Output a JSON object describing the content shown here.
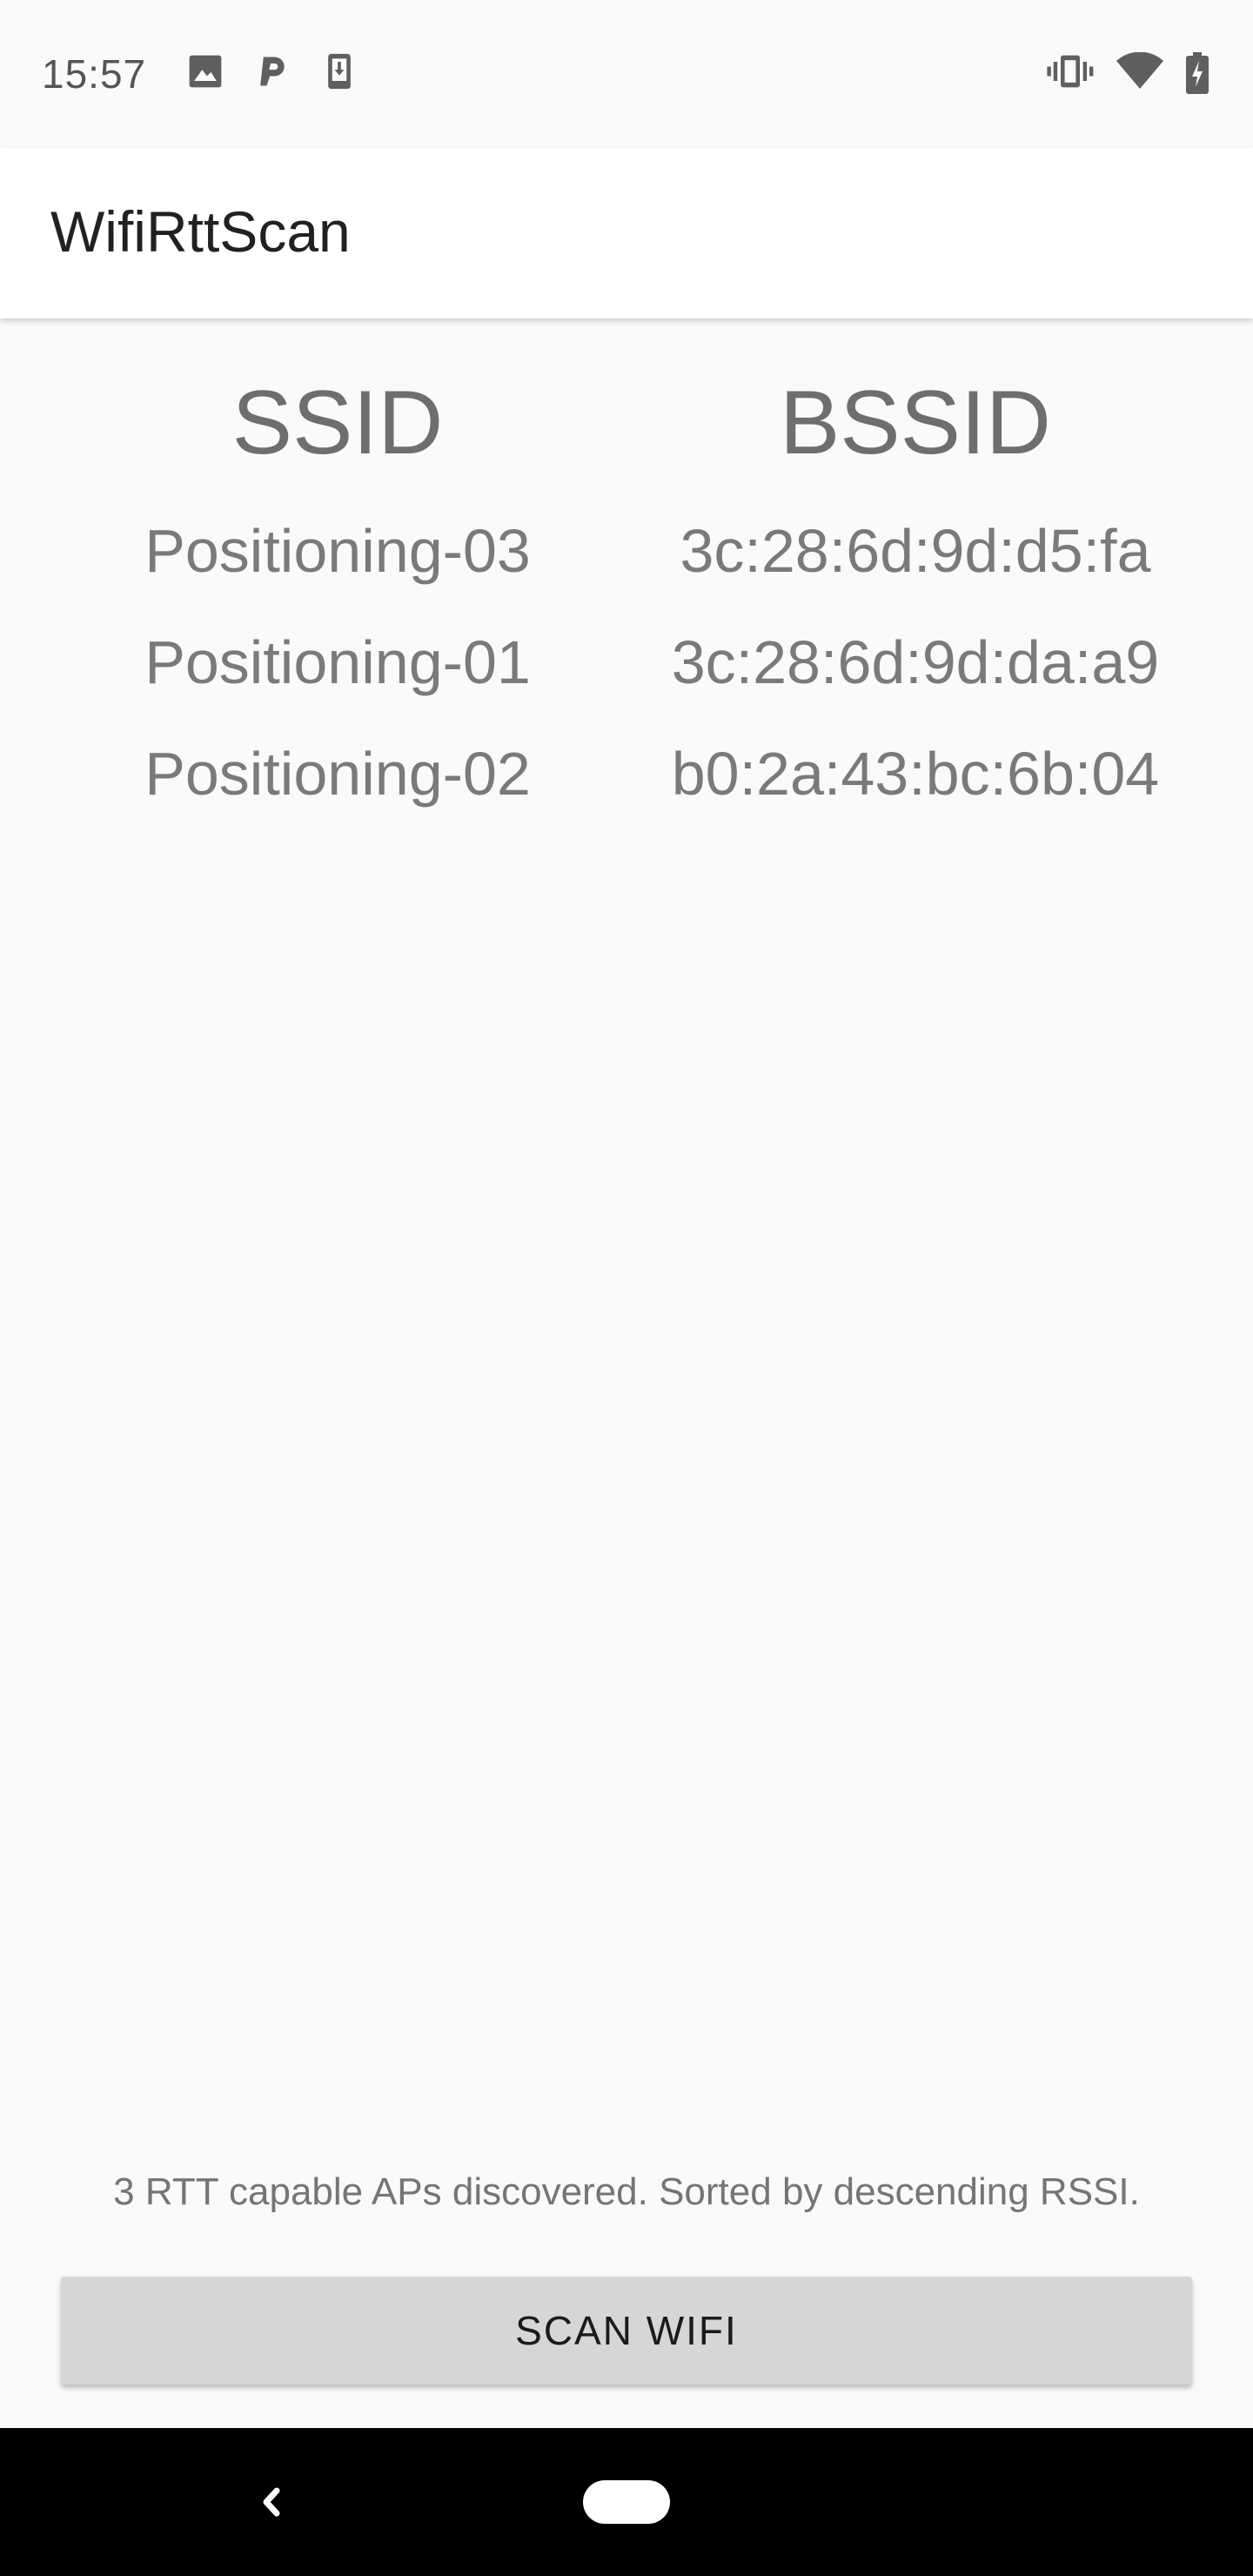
{
  "status_bar": {
    "time": "15:57",
    "left_icons": [
      "image-icon",
      "parking-icon",
      "download-icon"
    ],
    "right_icons": [
      "vibrate-icon",
      "wifi-icon",
      "battery-charging-icon"
    ]
  },
  "app_bar": {
    "title": "WifiRttScan"
  },
  "table": {
    "headers": {
      "ssid": "SSID",
      "bssid": "BSSID"
    },
    "rows": [
      {
        "ssid": "Positioning-03",
        "bssid": "3c:28:6d:9d:d5:fa"
      },
      {
        "ssid": "Positioning-01",
        "bssid": "3c:28:6d:9d:da:a9"
      },
      {
        "ssid": "Positioning-02",
        "bssid": "b0:2a:43:bc:6b:04"
      }
    ]
  },
  "footer": {
    "status_text": "3 RTT capable APs discovered. Sorted by descending RSSI."
  },
  "scan_button": {
    "label": "SCAN WIFI"
  },
  "nav_bar": {
    "icons": [
      "back-icon",
      "home-pill-icon"
    ]
  },
  "colors": {
    "background": "#fafafa",
    "app_bar": "#ffffff",
    "text_primary": "#212121",
    "text_secondary": "#757575",
    "button": "#d6d6d6",
    "nav_bar": "#000000"
  }
}
